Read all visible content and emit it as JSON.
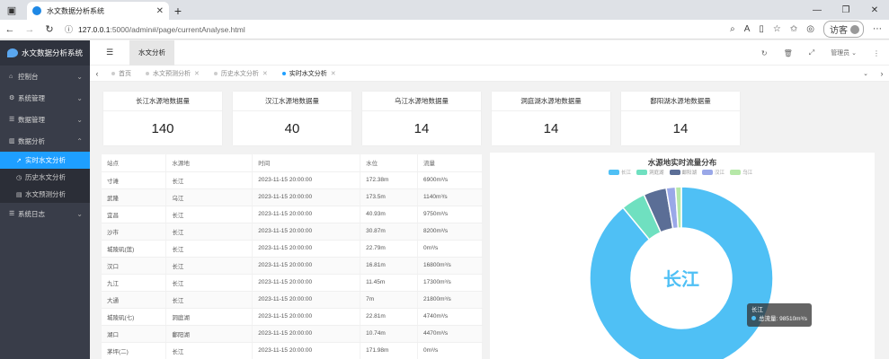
{
  "browser": {
    "tab_title": "水文数据分析系统",
    "url_host": "127.0.0.1",
    "url_path": ":5000/admin#/page/currentAnalyse.html",
    "guest_label": "访客"
  },
  "sidebar": {
    "logo": "水文数据分析系统",
    "items": [
      {
        "label": "控制台"
      },
      {
        "label": "系统管理"
      },
      {
        "label": "数据管理"
      },
      {
        "label": "数据分析"
      }
    ],
    "sub_items": [
      {
        "label": "实时水文分析"
      },
      {
        "label": "历史水文分析"
      },
      {
        "label": "水文预测分析"
      }
    ],
    "log_item": "系统日志"
  },
  "header": {
    "active_tab": "水文分析",
    "user": "管理员"
  },
  "tabstrip": {
    "tabs": [
      {
        "label": "首页"
      },
      {
        "label": "水文预测分析"
      },
      {
        "label": "历史水文分析"
      },
      {
        "label": "实时水文分析"
      }
    ]
  },
  "cards": [
    {
      "title": "长江水源地数据量",
      "value": "140"
    },
    {
      "title": "汉江水源地数据量",
      "value": "40"
    },
    {
      "title": "乌江水源地数据量",
      "value": "14"
    },
    {
      "title": "洞庭湖水源地数据量",
      "value": "14"
    },
    {
      "title": "鄱阳湖水源地数据量",
      "value": "14"
    }
  ],
  "table": {
    "headers": [
      "站点",
      "水源地",
      "时间",
      "水位",
      "流量"
    ],
    "rows": [
      [
        "寸滩",
        "长江",
        "2023-11-15 20:00:00",
        "172.38m",
        "6900m³/s"
      ],
      [
        "武隆",
        "乌江",
        "2023-11-15 20:00:00",
        "173.5m",
        "1140m³/s"
      ],
      [
        "宜昌",
        "长江",
        "2023-11-15 20:00:00",
        "40.93m",
        "9750m³/s"
      ],
      [
        "沙市",
        "长江",
        "2023-11-15 20:00:00",
        "30.87m",
        "8200m³/s"
      ],
      [
        "城陵矶(莲)",
        "长江",
        "2023-11-15 20:00:00",
        "22.79m",
        "0m³/s"
      ],
      [
        "汉口",
        "长江",
        "2023-11-15 20:00:00",
        "16.81m",
        "16800m³/s"
      ],
      [
        "九江",
        "长江",
        "2023-11-15 20:00:00",
        "11.45m",
        "17300m³/s"
      ],
      [
        "大通",
        "长江",
        "2023-11-15 20:00:00",
        "7m",
        "21800m³/s"
      ],
      [
        "城陵矶(七)",
        "洞庭湖",
        "2023-11-15 20:00:00",
        "22.81m",
        "4740m³/s"
      ],
      [
        "湖口",
        "鄱阳湖",
        "2023-11-15 20:00:00",
        "10.74m",
        "4470m³/s"
      ],
      [
        "茅坪(二)",
        "长江",
        "2023-11-15 20:00:00",
        "171.98m",
        "0m³/s"
      ]
    ]
  },
  "chart_data": {
    "type": "pie",
    "title": "水源地实时流量分布",
    "center_label": "长江",
    "categories": [
      "长江",
      "洞庭湖",
      "鄱阳湖",
      "汉江",
      "乌江"
    ],
    "values": [
      98510,
      4740,
      4470,
      1800,
      1140
    ],
    "colors": [
      "#4fc0f5",
      "#6fe0c0",
      "#5b6e96",
      "#9aa8e8",
      "#b6e8a8"
    ],
    "legend_position": "top",
    "tooltip": {
      "title": "长江",
      "line": "总流量: 98510m³/s"
    }
  }
}
